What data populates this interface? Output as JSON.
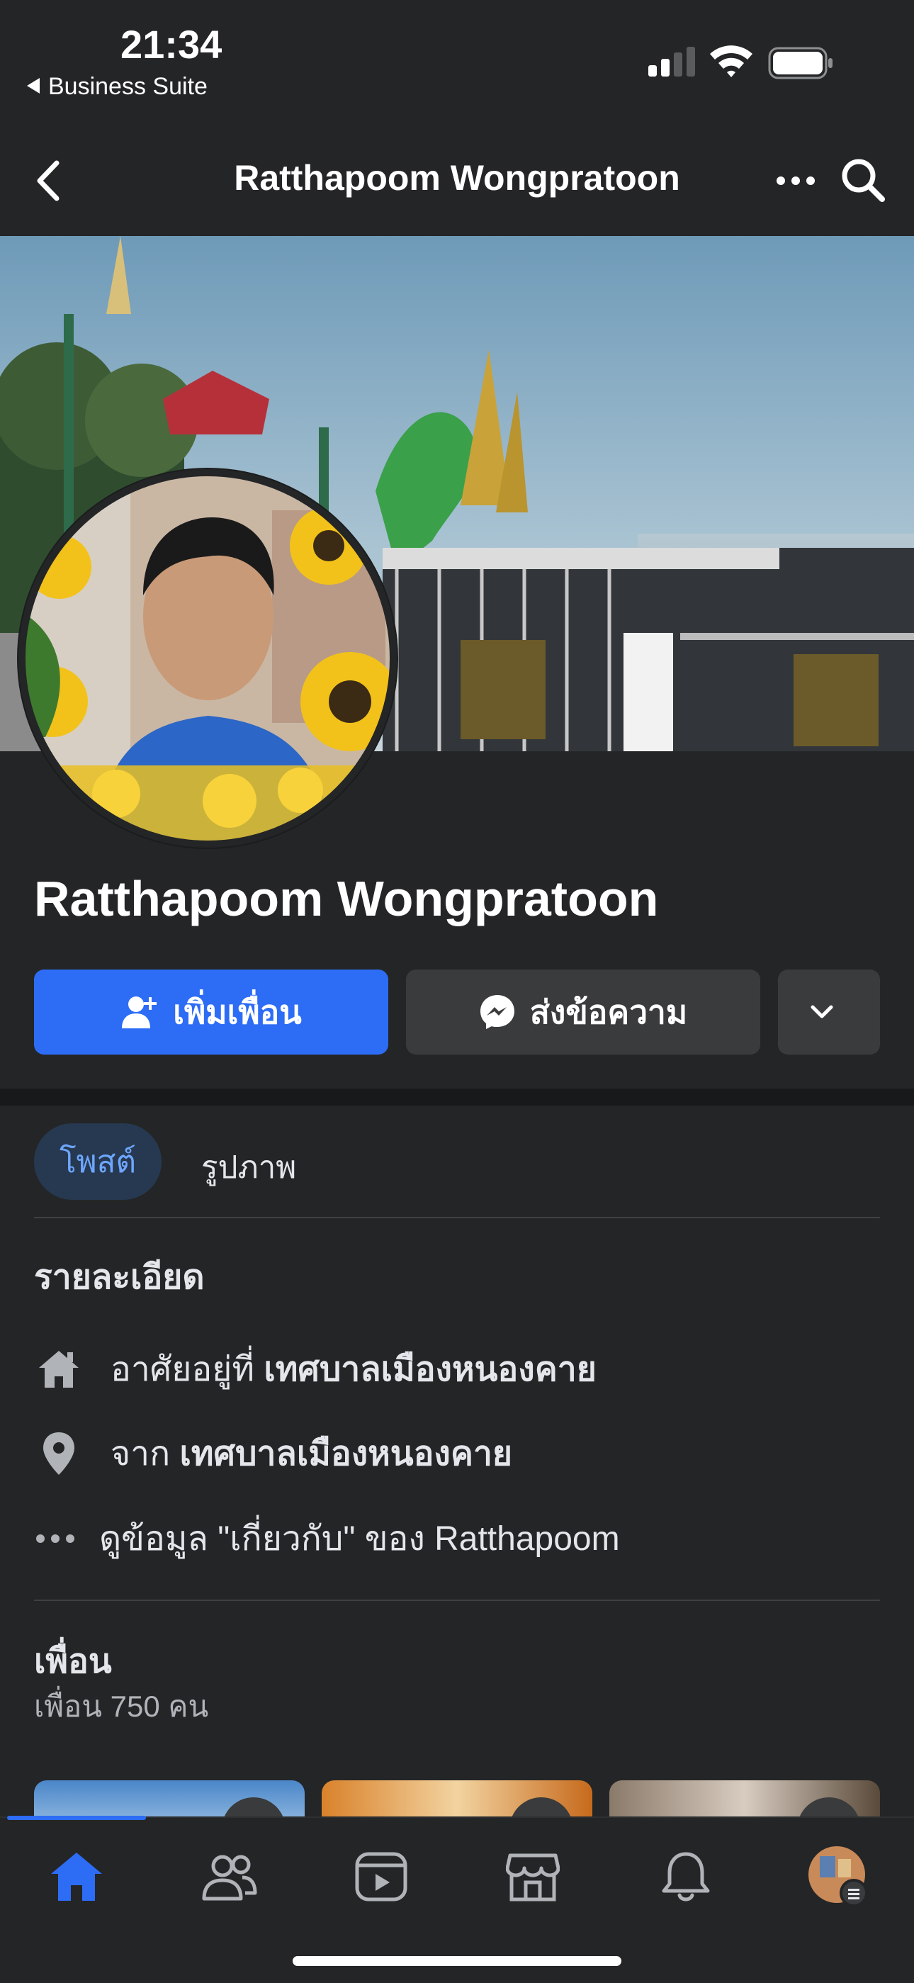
{
  "status_bar": {
    "time": "21:34",
    "back_app": "Business Suite"
  },
  "header": {
    "title": "Ratthapoom Wongpratoon"
  },
  "profile": {
    "name": "Ratthapoom Wongpratoon"
  },
  "actions": {
    "add_friend": "เพิ่มเพื่อน",
    "message": "ส่งข้อความ"
  },
  "tabs": [
    {
      "label": "โพสต์",
      "active": true
    },
    {
      "label": "รูปภาพ",
      "active": false
    }
  ],
  "details": {
    "heading": "รายละเอียด",
    "lives_in_prefix": "อาศัยอยู่ที่ ",
    "lives_in_place": "เทศบาลเมืองหนองคาย",
    "from_prefix": "จาก ",
    "from_place": "เทศบาลเมืองหนองคาย",
    "about_link": "ดูข้อมูล \"เกี่ยวกับ\" ของ Ratthapoom"
  },
  "friends": {
    "heading": "เพื่อน",
    "count": "เพื่อน 750 คน"
  },
  "colors": {
    "background": "#242526",
    "primary_blue": "#2d6cf5",
    "secondary_button": "#3a3b3c",
    "active_tab_bg": "#263951",
    "active_tab_text": "#6ea6ff"
  },
  "icons": [
    "back-chevron-icon",
    "more-icon",
    "search-icon",
    "add-person-icon",
    "messenger-icon",
    "chevron-down-icon",
    "home-icon",
    "pin-icon",
    "ellipsis-icon",
    "home-tab-icon",
    "friends-tab-icon",
    "video-tab-icon",
    "marketplace-tab-icon",
    "notifications-tab-icon",
    "profile-tab-avatar"
  ]
}
